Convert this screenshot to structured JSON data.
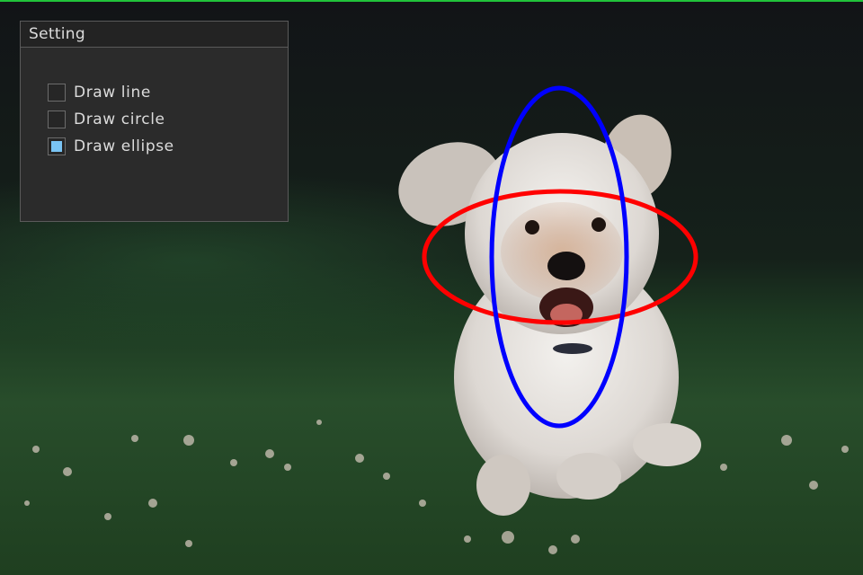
{
  "window": {
    "accent_line_color": "#21c23a"
  },
  "settings_panel": {
    "title": "Setting",
    "options": [
      {
        "label": "Draw line",
        "checked": false
      },
      {
        "label": "Draw circle",
        "checked": false
      },
      {
        "label": "Draw ellipse",
        "checked": true
      }
    ],
    "checkbox_checked_color": "#7ac4f4"
  },
  "canvas": {
    "subject": "photo-dog-running-on-grass",
    "overlays": [
      {
        "shape": "ellipse",
        "color": "#ff0000",
        "orientation": "horizontal"
      },
      {
        "shape": "ellipse",
        "color": "#0000ff",
        "orientation": "vertical"
      }
    ]
  }
}
